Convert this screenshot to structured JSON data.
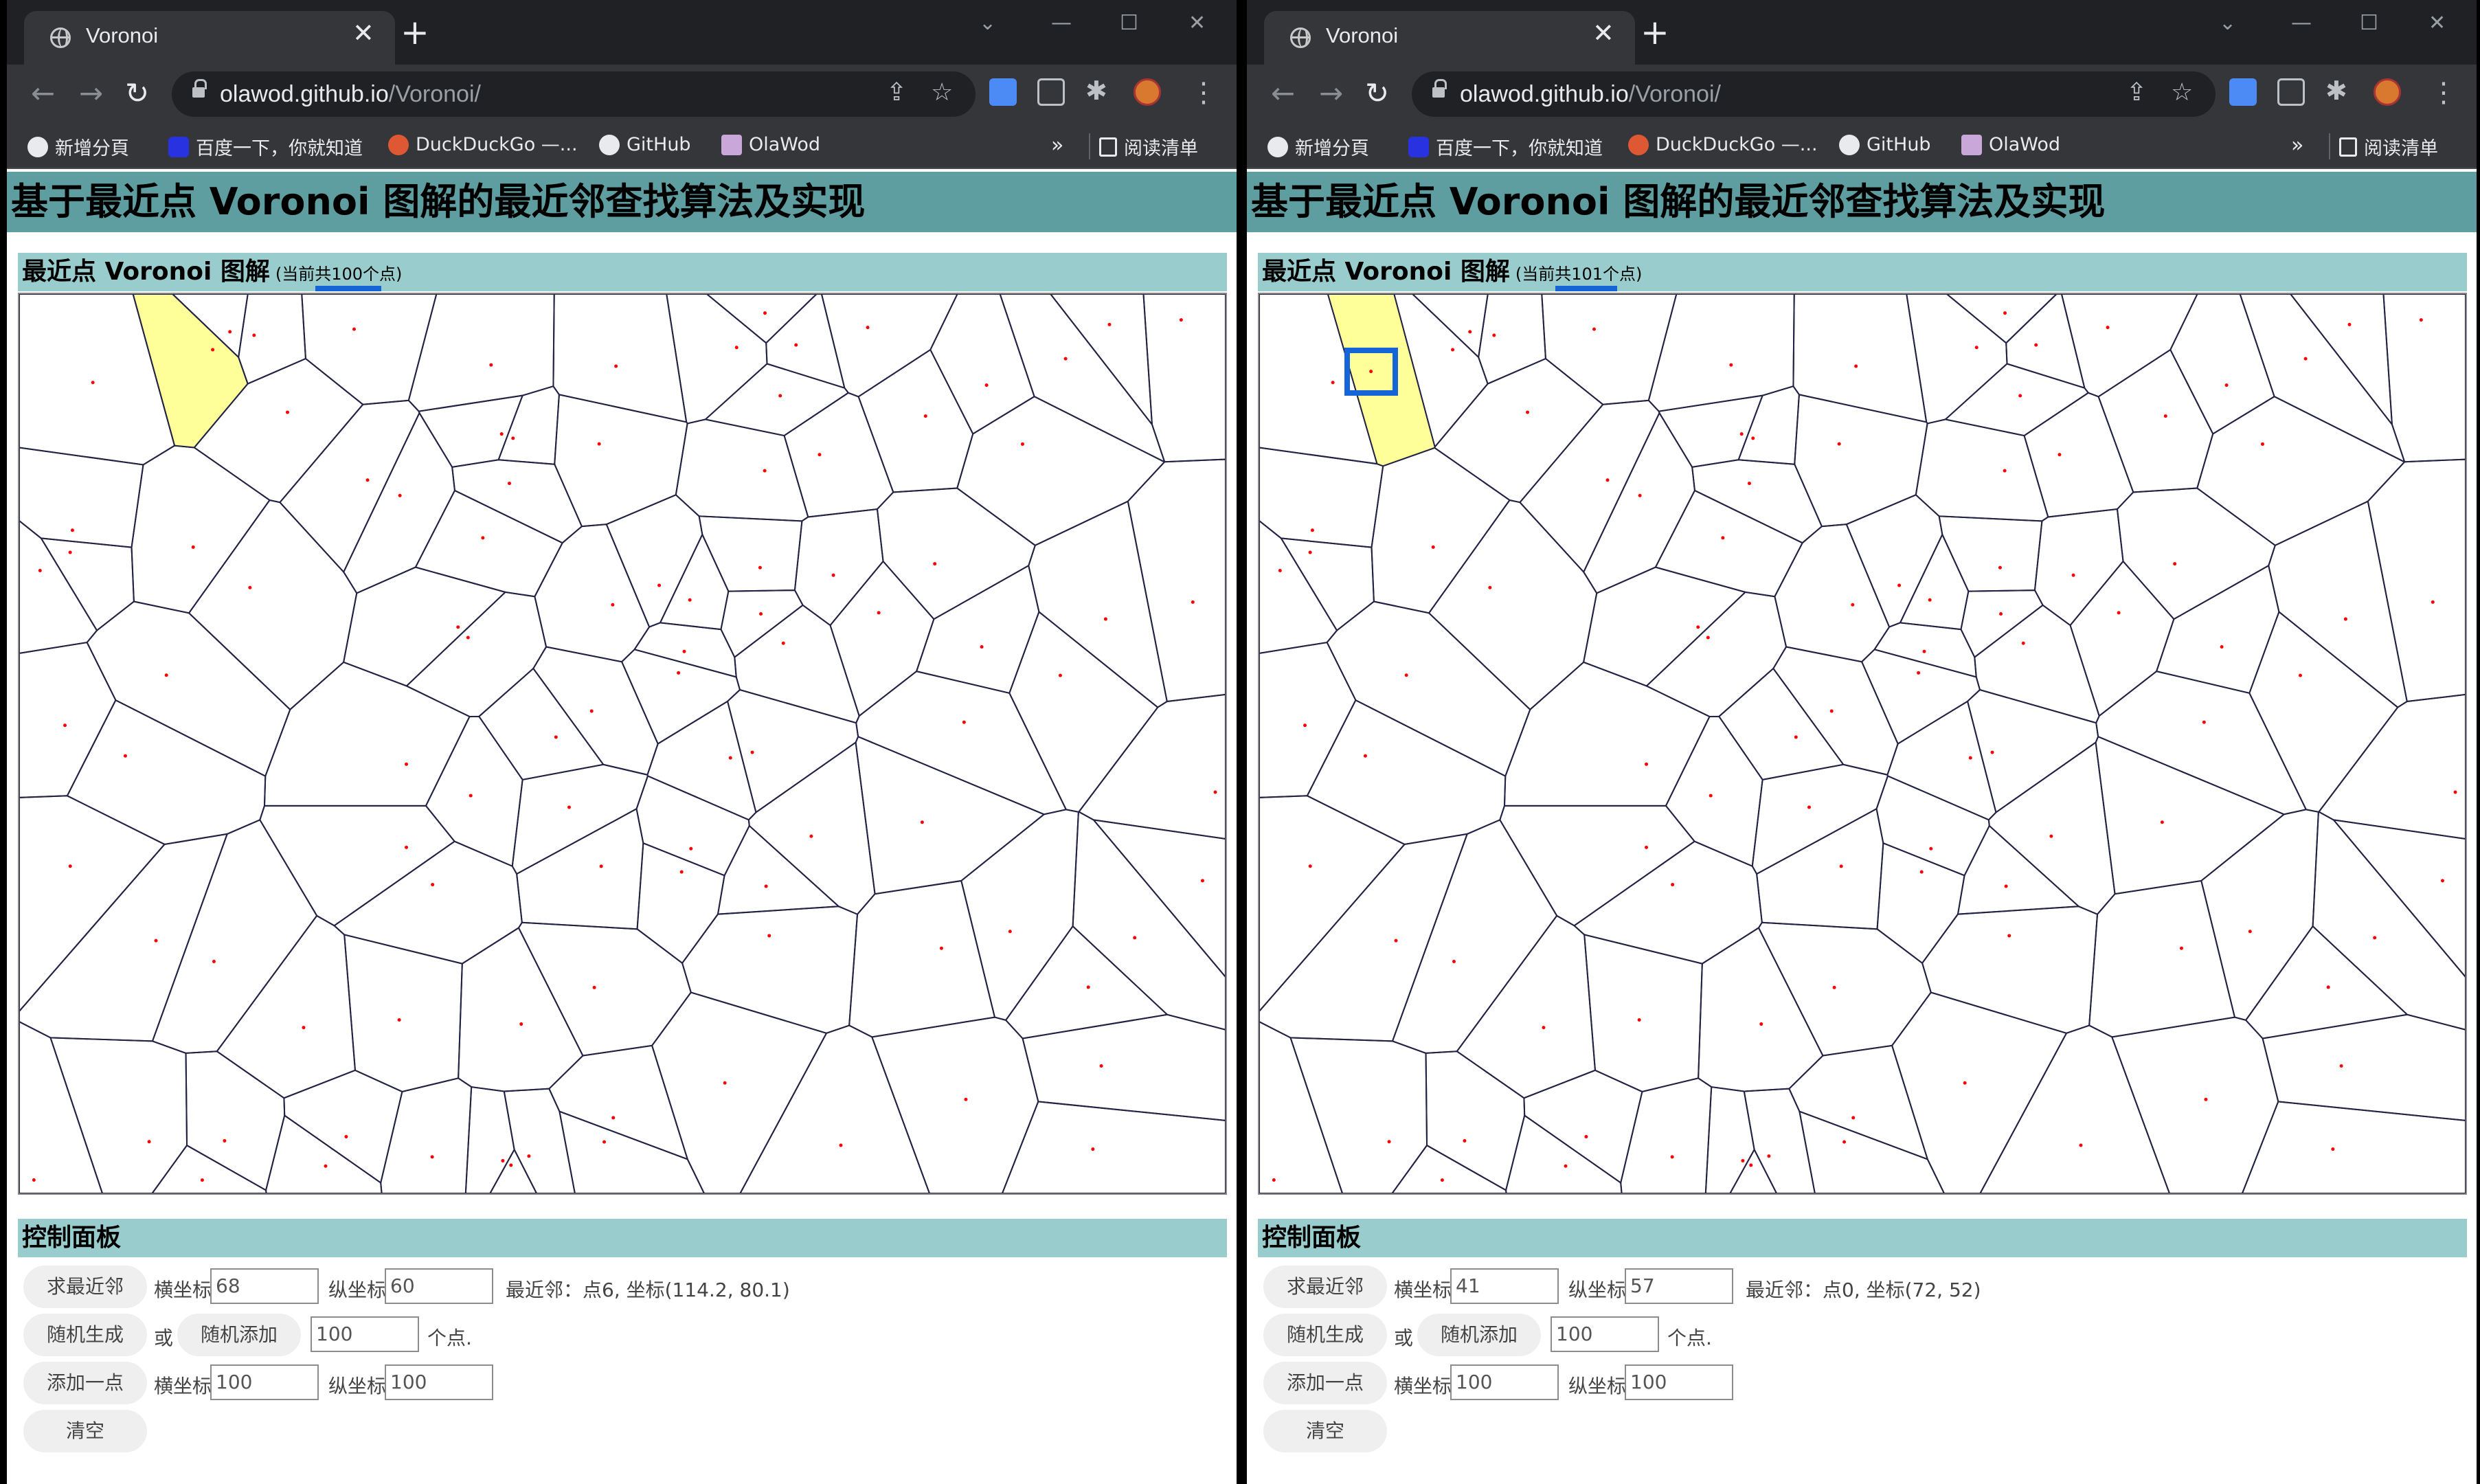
{
  "windows": [
    {
      "id": "left",
      "tab_title": "Voronoi",
      "url_host": "olawod.github.io",
      "url_path": "/Voronoi/",
      "bookmarks": [
        "新增分頁",
        "百度一下，你就知道",
        "DuckDuckGo —...",
        "GitHub",
        "OlaWod"
      ],
      "reading_list": "阅读清单",
      "page_title": "基于最近点 Voronoi 图解的最近邻查找算法及实现",
      "diagram_title": "最近点 Voronoi 图解",
      "point_count_text": "(当前共100个点)",
      "control_title": "控制面板",
      "controls": {
        "find_nearest": "求最近邻",
        "x_label": "横坐标",
        "y_label": "纵坐标",
        "query_x": "68",
        "query_y": "60",
        "result": "最近邻：点6, 坐标(114.2, 80.1)",
        "random_generate": "随机生成",
        "or": "或",
        "random_add": "随机添加",
        "random_count": "100",
        "points_suffix": "个点.",
        "add_point": "添加一点",
        "add_x_label": "横坐标",
        "add_y_label": "纵坐标",
        "add_x": "100",
        "add_y": "100",
        "clear": "清空"
      }
    },
    {
      "id": "right",
      "tab_title": "Voronoi",
      "url_host": "olawod.github.io",
      "url_path": "/Voronoi/",
      "bookmarks": [
        "新增分頁",
        "百度一下，你就知道",
        "DuckDuckGo —...",
        "GitHub",
        "OlaWod"
      ],
      "reading_list": "阅读清单",
      "page_title": "基于最近点 Voronoi 图解的最近邻查找算法及实现",
      "diagram_title": "最近点 Voronoi 图解",
      "point_count_text": "(当前共101个点)",
      "control_title": "控制面板",
      "controls": {
        "find_nearest": "求最近邻",
        "x_label": "横坐标",
        "y_label": "纵坐标",
        "query_x": "41",
        "query_y": "57",
        "result": "最近邻：点0, 坐标(72, 52)",
        "random_generate": "随机生成",
        "or": "或",
        "random_add": "随机添加",
        "random_count": "100",
        "points_suffix": "个点.",
        "add_point": "添加一点",
        "add_x_label": "横坐标",
        "add_y_label": "纵坐标",
        "add_x": "100",
        "add_y": "100",
        "clear": "清空"
      }
    }
  ],
  "colors": {
    "title_bar": "#5f9ea0",
    "section_bar": "#99cccc",
    "highlight_cell": "#ffff99",
    "site_point": "#ff0000",
    "edge": "#222244",
    "marker": "#1565d8"
  },
  "icons": {
    "tab": "globe-icon",
    "close": "close-icon",
    "back": "arrow-left-icon",
    "forward": "arrow-right-icon",
    "reload": "reload-icon",
    "lock": "lock-icon",
    "share": "share-icon",
    "star": "star-icon"
  }
}
